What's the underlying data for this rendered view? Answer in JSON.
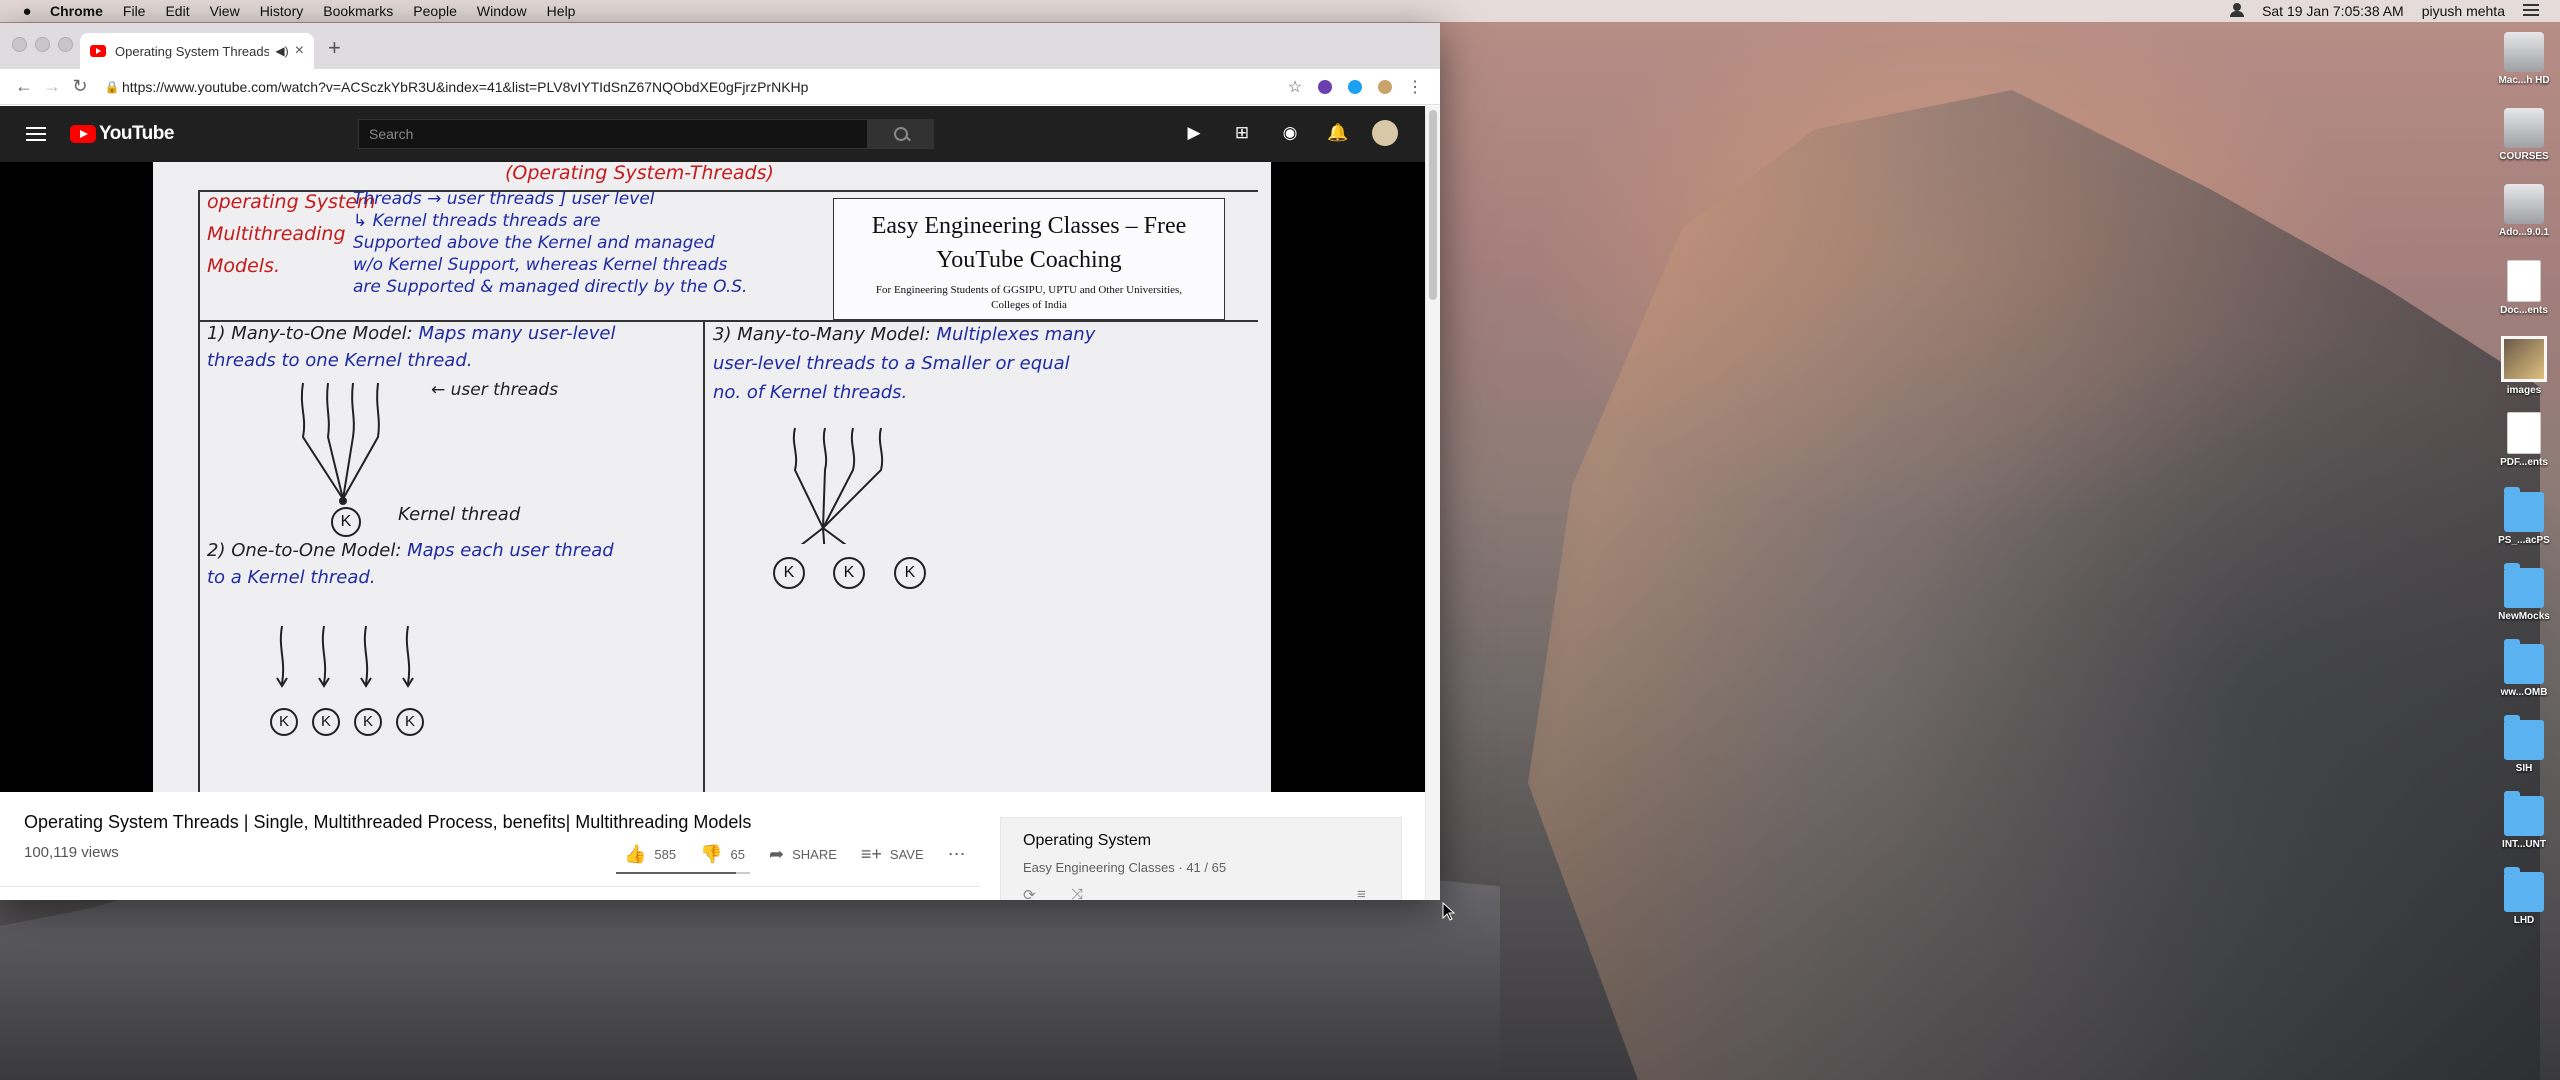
{
  "menubar": {
    "app": "Chrome",
    "items": [
      "File",
      "Edit",
      "View",
      "History",
      "Bookmarks",
      "People",
      "Window",
      "Help"
    ],
    "datetime": "Sat 19 Jan  7:05:38 AM",
    "user": "piyush mehta"
  },
  "browser": {
    "tab_title": "Operating System Threads",
    "url": "https://www.youtube.com/watch?v=ACSczkYbR3U&index=41&list=PLV8vIYTIdSnZ67NQObdXE0gFjrzPrNKHp"
  },
  "youtube": {
    "logo": "YouTube",
    "search_placeholder": "Search",
    "video_title": "Operating System Threads | Single, Multithreaded Process, benefits| Multithreading Models",
    "views": "100,119 views",
    "likes": "585",
    "dislikes": "65",
    "share_label": "SHARE",
    "save_label": "SAVE",
    "playlist": {
      "title": "Operating System",
      "channel": "Easy Engineering Classes",
      "position": "41 / 65"
    }
  },
  "board": {
    "heading": "(Operating System-Threads)",
    "left_title": [
      "operating System",
      "Multithreading",
      "Models."
    ],
    "intro": [
      "Threads → user threads ] user level",
      "↳ Kernel threads       threads are",
      "Supported above the Kernel and managed",
      "w/o Kernel Support, whereas Kernel threads",
      "are Supported & managed directly by the O.S."
    ],
    "banner": {
      "title_line1": "Easy Engineering Classes – Free",
      "title_line2": "YouTube Coaching",
      "subtitle_line1": "For Engineering Students of GGSIPU, UPTU and Other Universities,",
      "subtitle_line2": "Colleges of India"
    },
    "m1_heading": "1) Many-to-One Model:",
    "m1_text": [
      "Maps many user-level",
      "threads to one Kernel thread."
    ],
    "m1_user_label": "← user threads",
    "m1_kernel_label": "Kernel thread",
    "m2_heading": "2) One-to-One Model:",
    "m2_text": [
      "Maps each user thread",
      "to a Kernel thread."
    ],
    "m3_heading": "3) Many-to-Many Model:",
    "m3_text": [
      "Multiplexes many",
      "user-level threads to a Smaller or equal",
      "no. of Kernel threads."
    ],
    "kernel_symbol": "K"
  },
  "desktop": {
    "items": [
      {
        "label": "Mac...h HD",
        "icon": "hard-drive-icon"
      },
      {
        "label": "COURSES",
        "icon": "hard-drive-icon"
      },
      {
        "label": "Ado...9.0.1",
        "icon": "disk-image-icon"
      },
      {
        "label": "Doc...ents",
        "icon": "document-icon"
      },
      {
        "label": "images",
        "icon": "image-icon"
      },
      {
        "label": "PDF...ents",
        "icon": "document-icon"
      },
      {
        "label": "PS_...acPS",
        "icon": "folder-icon"
      },
      {
        "label": "NewMocks",
        "icon": "folder-icon"
      },
      {
        "label": "ww...OMB",
        "icon": "folder-icon"
      },
      {
        "label": "SIH",
        "icon": "folder-icon"
      },
      {
        "label": "INT...UNT",
        "icon": "folder-icon"
      },
      {
        "label": "LHD",
        "icon": "folder-icon"
      }
    ]
  },
  "colors": {
    "youtube_red": "#ff0000",
    "youtube_header": "#202020",
    "board_red": "#c51a1a",
    "board_blue": "#1f2ba0",
    "board_green": "#138a30"
  }
}
